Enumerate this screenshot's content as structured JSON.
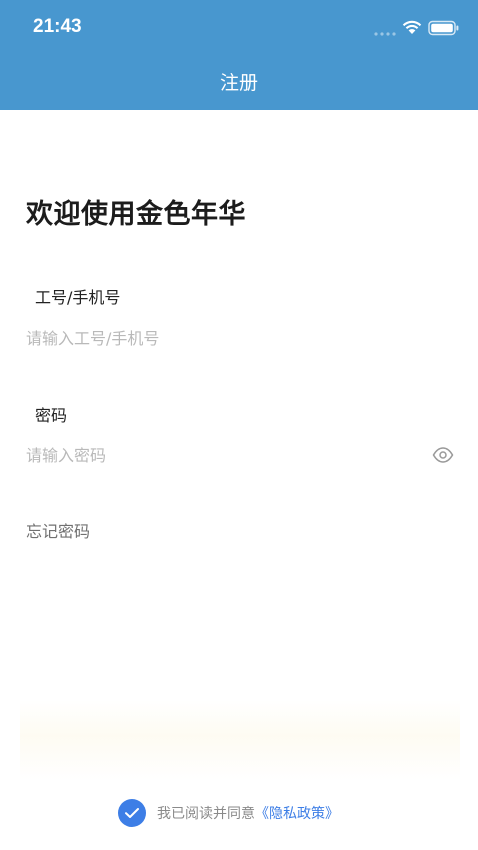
{
  "status_bar": {
    "time": "21:43"
  },
  "header": {
    "title": "注册"
  },
  "welcome": {
    "title": "欢迎使用金色年华"
  },
  "account_field": {
    "label": "工号/手机号",
    "placeholder": "请输入工号/手机号",
    "value": ""
  },
  "password_field": {
    "label": "密码",
    "placeholder": "请输入密码",
    "value": ""
  },
  "forgot_password": "忘记密码",
  "agreement": {
    "text": "我已阅读并同意",
    "link": "《隐私政策》",
    "checked": true
  },
  "colors": {
    "header_bg": "#4897cf",
    "accent": "#3d7ee6",
    "placeholder": "#b9b9b9"
  },
  "icons": [
    "signal-icon",
    "wifi-icon",
    "battery-icon",
    "eye-icon",
    "check-icon"
  ]
}
